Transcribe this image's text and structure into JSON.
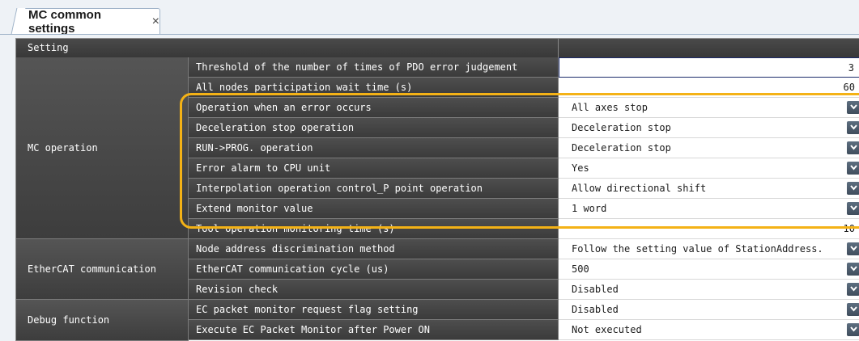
{
  "tab": {
    "title": "MC common settings",
    "close_symbol": "×"
  },
  "header": {
    "setting_label": "Setting"
  },
  "groups": [
    {
      "label": "MC operation"
    },
    {
      "label": "EtherCAT communication"
    },
    {
      "label": "Debug function"
    }
  ],
  "rows": [
    {
      "label": "Threshold of the number of times of PDO error judgement",
      "value": "3",
      "type": "number"
    },
    {
      "label": "All nodes participation wait time (s)",
      "value": "60",
      "type": "number"
    },
    {
      "label": "Operation when an error occurs",
      "value": "All axes stop",
      "type": "dropdown"
    },
    {
      "label": "Deceleration stop operation",
      "value": "Deceleration stop",
      "type": "dropdown"
    },
    {
      "label": "RUN->PROG. operation",
      "value": "Deceleration stop",
      "type": "dropdown"
    },
    {
      "label": "Error alarm to CPU unit",
      "value": "Yes",
      "type": "dropdown"
    },
    {
      "label": "Interpolation operation control_P point operation",
      "value": "Allow directional shift",
      "type": "dropdown"
    },
    {
      "label": "Extend monitor value",
      "value": "1 word",
      "type": "dropdown"
    },
    {
      "label": "Tool operation monitoring time (s)",
      "value": "10",
      "type": "number"
    },
    {
      "label": "Node address discrimination method",
      "value": "Follow the setting value of StationAddress.",
      "type": "dropdown"
    },
    {
      "label": "EtherCAT communication cycle (us)",
      "value": "500",
      "type": "dropdown"
    },
    {
      "label": "Revision check",
      "value": "Disabled",
      "type": "dropdown"
    },
    {
      "label": "EC packet monitor request flag setting",
      "value": "Disabled",
      "type": "dropdown"
    },
    {
      "label": "Execute EC Packet Monitor after Power ON",
      "value": "Not executed",
      "type": "dropdown"
    }
  ],
  "colors": {
    "highlight": "#f4b216",
    "header_bg": "#3d3d3d",
    "dropdown_button": "#4b5a6a"
  },
  "icons": {
    "dropdown": "chevron-down-icon",
    "close": "close-icon"
  }
}
